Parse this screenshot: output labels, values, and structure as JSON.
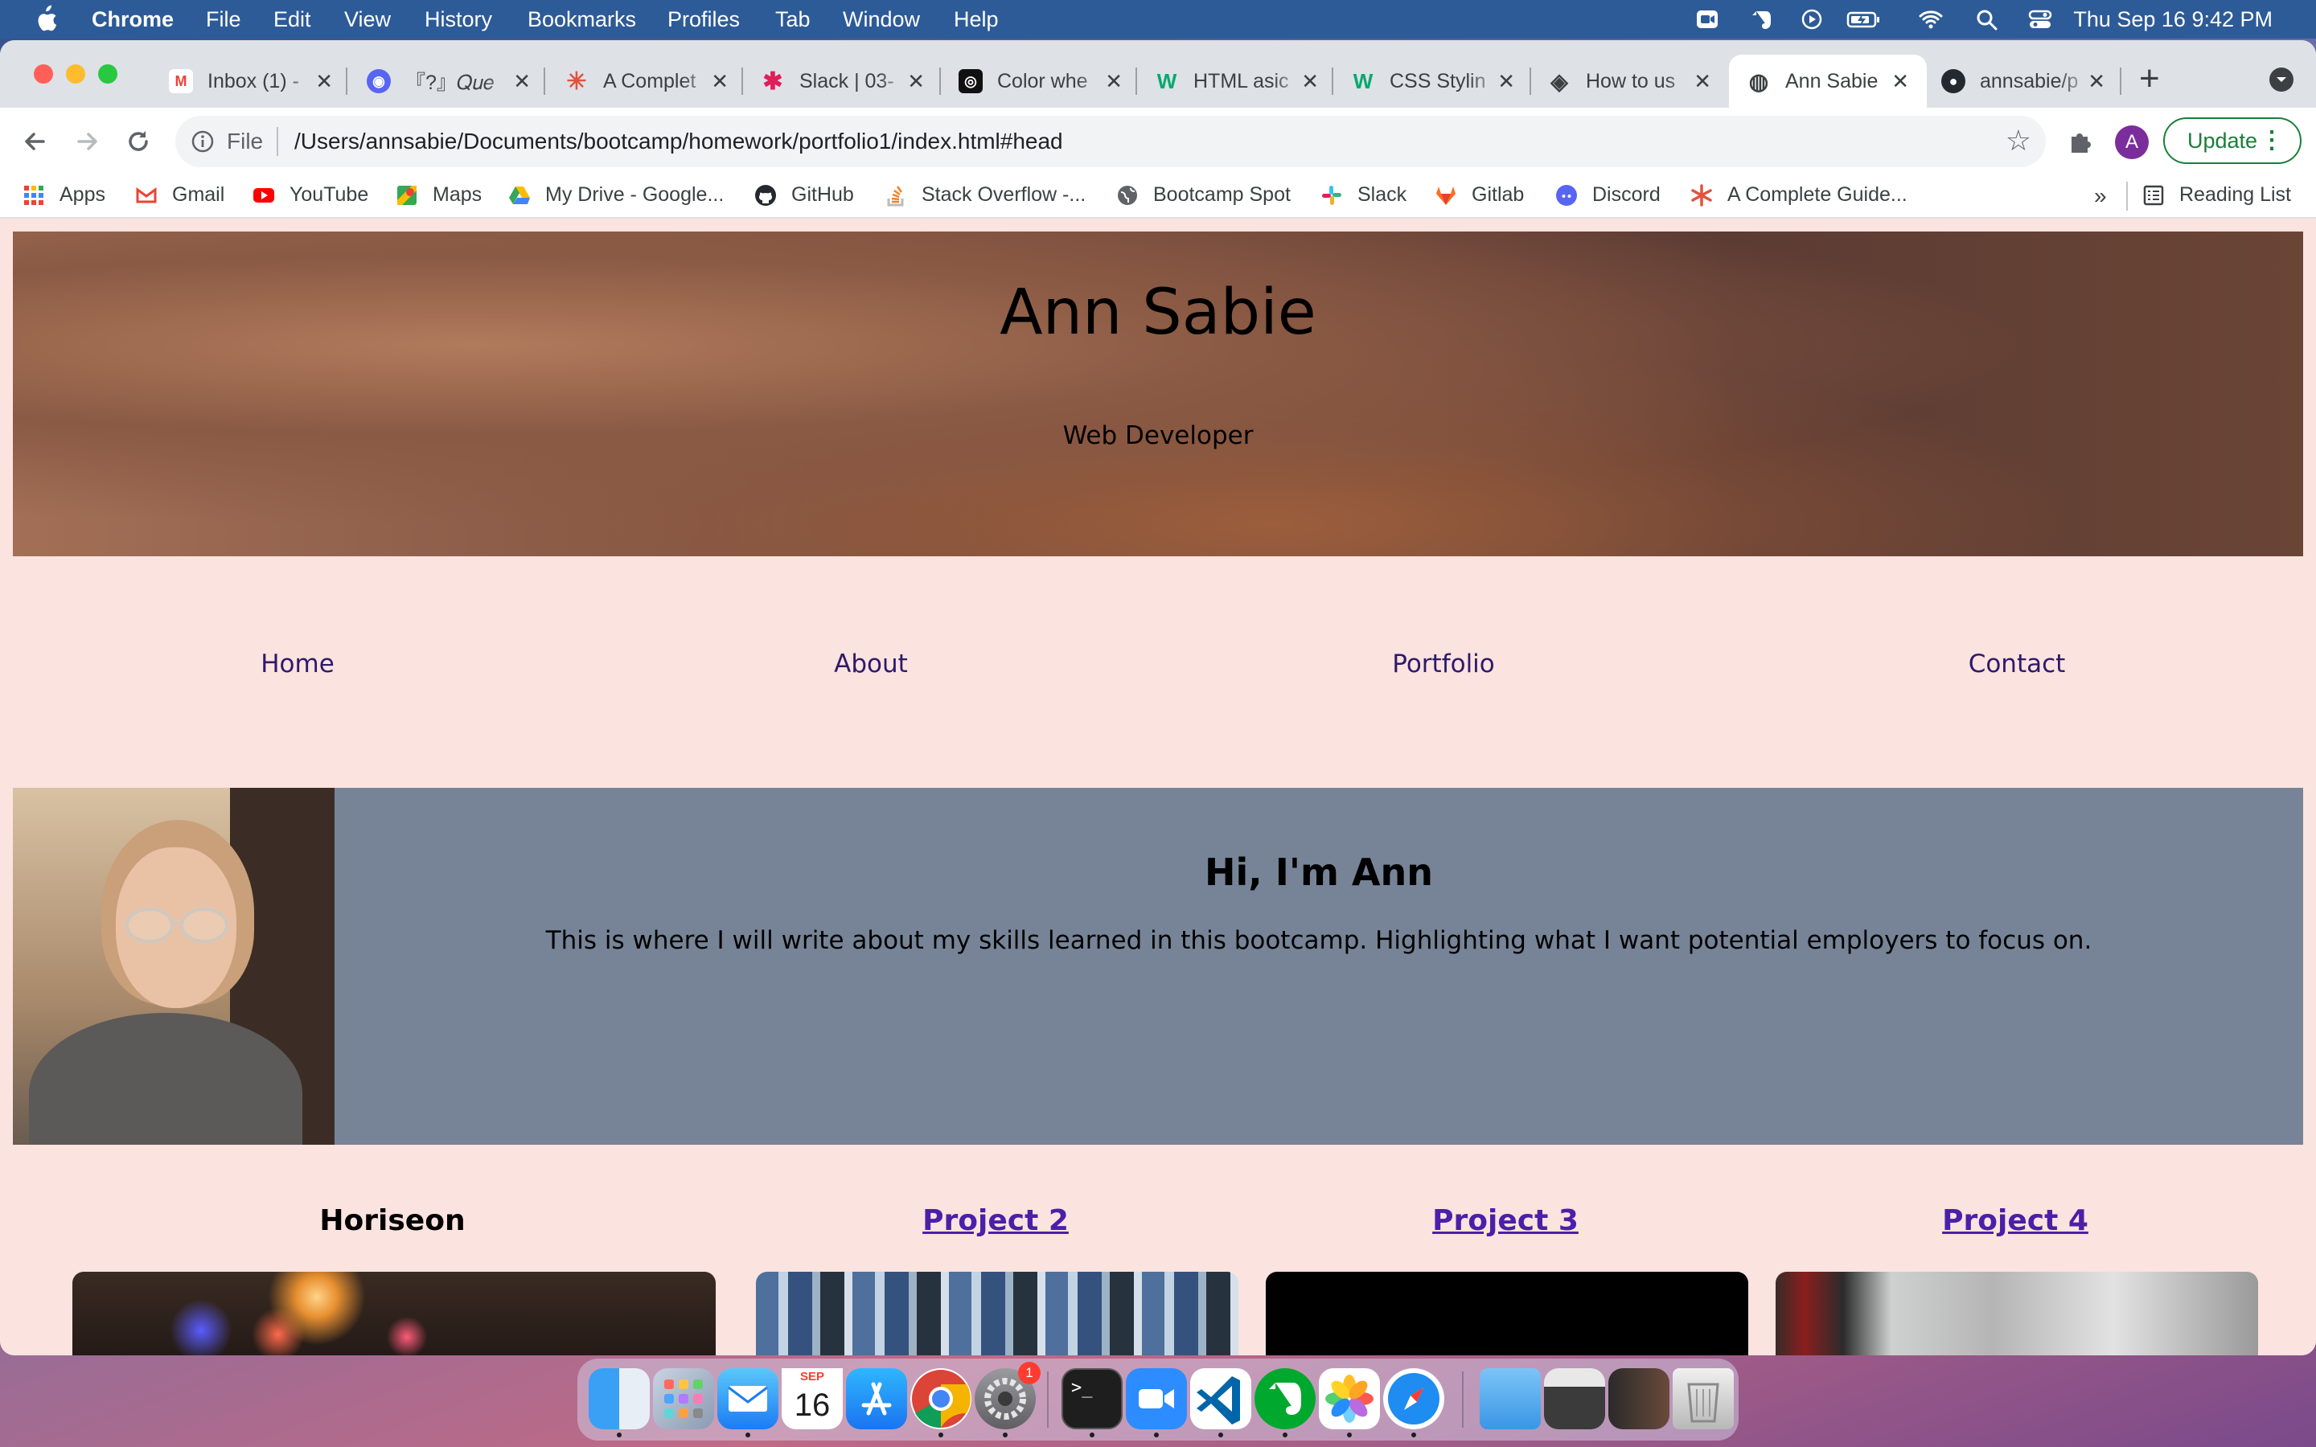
{
  "menubar": {
    "app": "Chrome",
    "items": [
      "File",
      "Edit",
      "View",
      "History",
      "Bookmarks",
      "Profiles",
      "Tab",
      "Window",
      "Help"
    ],
    "clock": "Thu Sep 16  9:42 PM"
  },
  "tabs": [
    {
      "title": "Inbox (1) -",
      "icon": "gmail-icon"
    },
    {
      "title": "『?』𝑄𝑢𝑒",
      "icon": "discord-icon"
    },
    {
      "title": "A Complet",
      "icon": "asterisk-icon"
    },
    {
      "title": "Slack | 03-",
      "icon": "slack-icon"
    },
    {
      "title": "Color whe",
      "icon": "colorwheel-icon"
    },
    {
      "title": "HTML asic",
      "icon": "w3-icon"
    },
    {
      "title": "CSS Stylin",
      "icon": "w3-icon"
    },
    {
      "title": "How to us",
      "icon": "diamond-icon"
    },
    {
      "title": "Ann Sabie",
      "icon": "globe-icon"
    },
    {
      "title": "annsabie/p",
      "icon": "github-icon"
    }
  ],
  "toolbar": {
    "scheme": "File",
    "url": "/Users/annsabie/Documents/bootcamp/homework/portfolio1/index.html#head",
    "avatar": "A",
    "update": "Update"
  },
  "bookmarks": [
    {
      "label": "Apps",
      "icon": "apps-grid-icon"
    },
    {
      "label": "Gmail",
      "icon": "gmail-icon"
    },
    {
      "label": "YouTube",
      "icon": "youtube-icon"
    },
    {
      "label": "Maps",
      "icon": "maps-icon"
    },
    {
      "label": "My Drive - Google...",
      "icon": "drive-icon"
    },
    {
      "label": "GitHub",
      "icon": "github-icon"
    },
    {
      "label": "Stack Overflow -...",
      "icon": "stackoverflow-icon"
    },
    {
      "label": "Bootcamp Spot",
      "icon": "globe-icon"
    },
    {
      "label": "Slack",
      "icon": "slack-icon"
    },
    {
      "label": "Gitlab",
      "icon": "gitlab-icon"
    },
    {
      "label": "Discord",
      "icon": "discord-icon"
    },
    {
      "label": "A Complete Guide...",
      "icon": "asterisk-icon"
    }
  ],
  "bookmarks_overflow": "»",
  "reading_list": "Reading List",
  "site": {
    "name": "Ann Sabie",
    "subtitle": "Web Developer",
    "nav": [
      "Home",
      "About",
      "Portfolio",
      "Contact"
    ],
    "about_heading": "Hi, I'm Ann",
    "about_text": "This is where I will write about my skills learned in this bootcamp. Highlighting what I want potential employers to focus on.",
    "projects": [
      {
        "title": "Horiseon",
        "linked": false
      },
      {
        "title": "Project 2",
        "linked": true
      },
      {
        "title": "Project 3",
        "linked": true
      },
      {
        "title": "Project 4",
        "linked": true
      }
    ]
  },
  "dock": {
    "calendar_month": "SEP",
    "calendar_day": "16",
    "settings_badge": "1"
  },
  "colors": {
    "accent_link": "#2e1a6b",
    "about_bg": "#778497",
    "page_bg": "#fbe3df"
  }
}
